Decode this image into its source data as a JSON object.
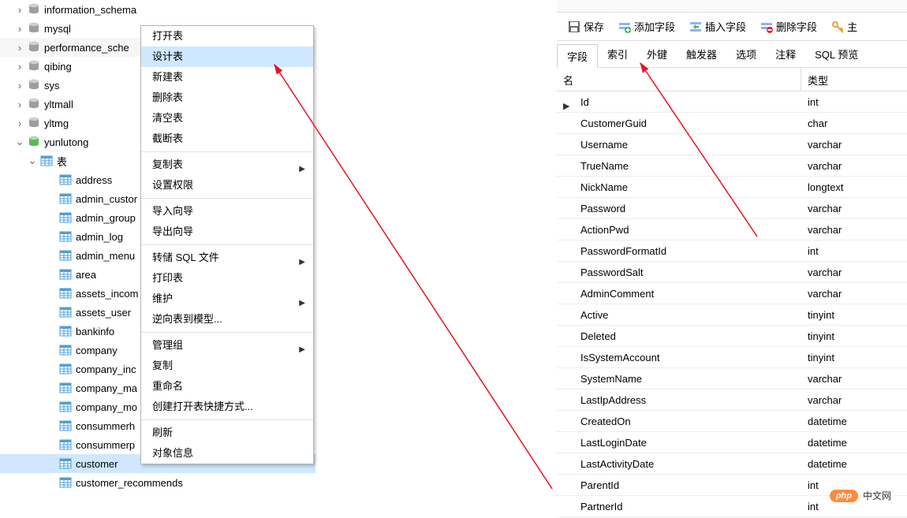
{
  "tree": {
    "databases": [
      {
        "label": "information_schema",
        "expanded": false
      },
      {
        "label": "mysql",
        "expanded": false
      },
      {
        "label": "performance_sche",
        "expanded": false,
        "grey": true
      },
      {
        "label": "qibing",
        "expanded": false
      },
      {
        "label": "sys",
        "expanded": false
      },
      {
        "label": "yltmall",
        "expanded": false
      },
      {
        "label": "yltmg",
        "expanded": false
      }
    ],
    "current_db": {
      "label": "yunlutong",
      "expanded": true
    },
    "tables_folder_label": "表",
    "tables": [
      "address",
      "admin_custor",
      "admin_group",
      "admin_log",
      "admin_menu",
      "area",
      "assets_incom",
      "assets_user",
      "bankinfo",
      "company",
      "company_inc",
      "company_ma",
      "company_mo",
      "consummerh",
      "consummerp",
      "customer",
      "customer_recommends"
    ],
    "selected_table_index": 15
  },
  "context_menu": {
    "groups": [
      [
        "打开表",
        "设计表",
        "新建表",
        "删除表",
        "清空表",
        "截断表"
      ],
      [
        "复制表",
        "设置权限"
      ],
      [
        "导入向导",
        "导出向导"
      ],
      [
        "转储 SQL 文件",
        "打印表",
        "维护",
        "逆向表到模型..."
      ],
      [
        "管理组",
        "复制",
        "重命名",
        "创建打开表快捷方式..."
      ],
      [
        "刷新",
        "对象信息"
      ]
    ],
    "submenu_items": [
      "复制表",
      "转储 SQL 文件",
      "维护",
      "管理组"
    ],
    "highlighted": "设计表"
  },
  "toolbar": {
    "save": "保存",
    "add_field": "添加字段",
    "insert_field": "插入字段",
    "delete_field": "删除字段",
    "primary": "主"
  },
  "tabs": [
    "字段",
    "索引",
    "外键",
    "触发器",
    "选项",
    "注释",
    "SQL 预览"
  ],
  "active_tab_index": 0,
  "field_header": {
    "name": "名",
    "type": "类型"
  },
  "fields": [
    {
      "name": "Id",
      "type": "int",
      "ptr": true
    },
    {
      "name": "CustomerGuid",
      "type": "char"
    },
    {
      "name": "Username",
      "type": "varchar"
    },
    {
      "name": "TrueName",
      "type": "varchar"
    },
    {
      "name": "NickName",
      "type": "longtext"
    },
    {
      "name": "Password",
      "type": "varchar"
    },
    {
      "name": "ActionPwd",
      "type": "varchar"
    },
    {
      "name": "PasswordFormatId",
      "type": "int"
    },
    {
      "name": "PasswordSalt",
      "type": "varchar"
    },
    {
      "name": "AdminComment",
      "type": "varchar"
    },
    {
      "name": "Active",
      "type": "tinyint"
    },
    {
      "name": "Deleted",
      "type": "tinyint"
    },
    {
      "name": "IsSystemAccount",
      "type": "tinyint"
    },
    {
      "name": "SystemName",
      "type": "varchar"
    },
    {
      "name": "LastIpAddress",
      "type": "varchar"
    },
    {
      "name": "CreatedOn",
      "type": "datetime"
    },
    {
      "name": "LastLoginDate",
      "type": "datetime"
    },
    {
      "name": "LastActivityDate",
      "type": "datetime"
    },
    {
      "name": "ParentId",
      "type": "int"
    },
    {
      "name": "PartnerId",
      "type": "int"
    }
  ],
  "watermark": {
    "badge": "php",
    "text": "中文网"
  }
}
